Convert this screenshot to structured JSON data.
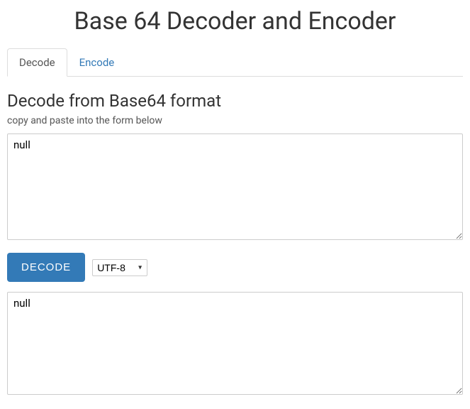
{
  "title": "Base 64 Decoder and Encoder",
  "tabs": {
    "decode": "Decode",
    "encode": "Encode"
  },
  "heading": "Decode from Base64 format",
  "instruction": "copy and paste into the form below",
  "input_value": "null",
  "decode_button": "DECODE",
  "encoding_selected": "UTF-8",
  "output_value": "null"
}
